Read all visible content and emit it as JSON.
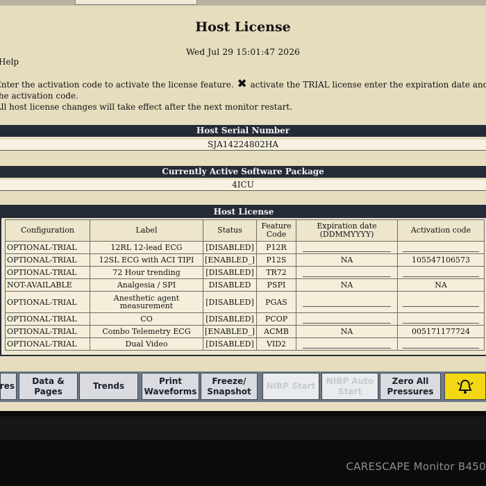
{
  "screen": {
    "title": "Host License",
    "datetime": "Wed Jul 29 15:01:47 2026",
    "help_label": "Help",
    "instructions": {
      "line1_a": "Enter the activation code to activate the license feature.",
      "line1_b": "activate the TRIAL license enter the expiration date and",
      "line2": "the activation code.",
      "line3": "All host license changes will take effect after the next monitor restart."
    }
  },
  "serial": {
    "header": "Host Serial Number",
    "value": "SJA14224802HA"
  },
  "software": {
    "header": "Currently Active Software Package",
    "value": "4ICU"
  },
  "license": {
    "header": "Host License",
    "columns": {
      "configuration": "Configuration",
      "label": "Label",
      "status": "Status",
      "feature_code": "Feature Code",
      "expiration": "Expiration date (DDMMYYYY)",
      "activation": "Activation code"
    },
    "rows": [
      {
        "configuration": "OPTIONAL-TRIAL",
        "label": "12RL 12-lead ECG",
        "status": "[DISABLED]",
        "code": "P12R",
        "expiration": "",
        "activation": ""
      },
      {
        "configuration": "OPTIONAL-TRIAL",
        "label": "12SL ECG with ACI TIPI",
        "status": "[ENABLED_]",
        "code": "P12S",
        "expiration": "NA",
        "activation": "105547106573"
      },
      {
        "configuration": "OPTIONAL-TRIAL",
        "label": "72 Hour trending",
        "status": "[DISABLED]",
        "code": "TR72",
        "expiration": "",
        "activation": ""
      },
      {
        "configuration": "NOT-AVAILABLE",
        "label": "Analgesia / SPI",
        "status": "DISABLED",
        "code": "PSPI",
        "expiration": "NA",
        "activation": "NA"
      },
      {
        "configuration": "OPTIONAL-TRIAL",
        "label": "Anesthetic agent measurement",
        "status": "[DISABLED]",
        "code": "PGAS",
        "expiration": "",
        "activation": ""
      },
      {
        "configuration": "OPTIONAL-TRIAL",
        "label": "CO",
        "status": "[DISABLED]",
        "code": "PCOP",
        "expiration": "",
        "activation": ""
      },
      {
        "configuration": "OPTIONAL-TRIAL",
        "label": "Combo Telemetry ECG",
        "status": "[ENABLED_]",
        "code": "ACMB",
        "expiration": "NA",
        "activation": "005171177724"
      },
      {
        "configuration": "OPTIONAL-TRIAL",
        "label": "Dual Video",
        "status": "[DISABLED]",
        "code": "VID2",
        "expiration": "",
        "activation": ""
      }
    ]
  },
  "bottom_bar": {
    "buttons": [
      {
        "label": "res",
        "enabled": true
      },
      {
        "label": "Data & Pages",
        "enabled": true
      },
      {
        "label": "Trends",
        "enabled": true
      },
      {
        "label": "Print Waveforms",
        "enabled": true
      },
      {
        "label": "Freeze/ Snapshot",
        "enabled": true
      },
      {
        "label": "NIBP Start",
        "enabled": false
      },
      {
        "label": "NIBP Auto Start",
        "enabled": false
      },
      {
        "label": "Zero All Pressures",
        "enabled": true
      }
    ],
    "alarm_icon": "bell-alarm-icon"
  },
  "device": {
    "brand": "CARESCAPE Monitor B450"
  },
  "colors": {
    "screen_bg": "#e6ddbf",
    "header_bar": "#242a36",
    "button_bar": "#6f7a88",
    "alarm": "#f2d814"
  }
}
